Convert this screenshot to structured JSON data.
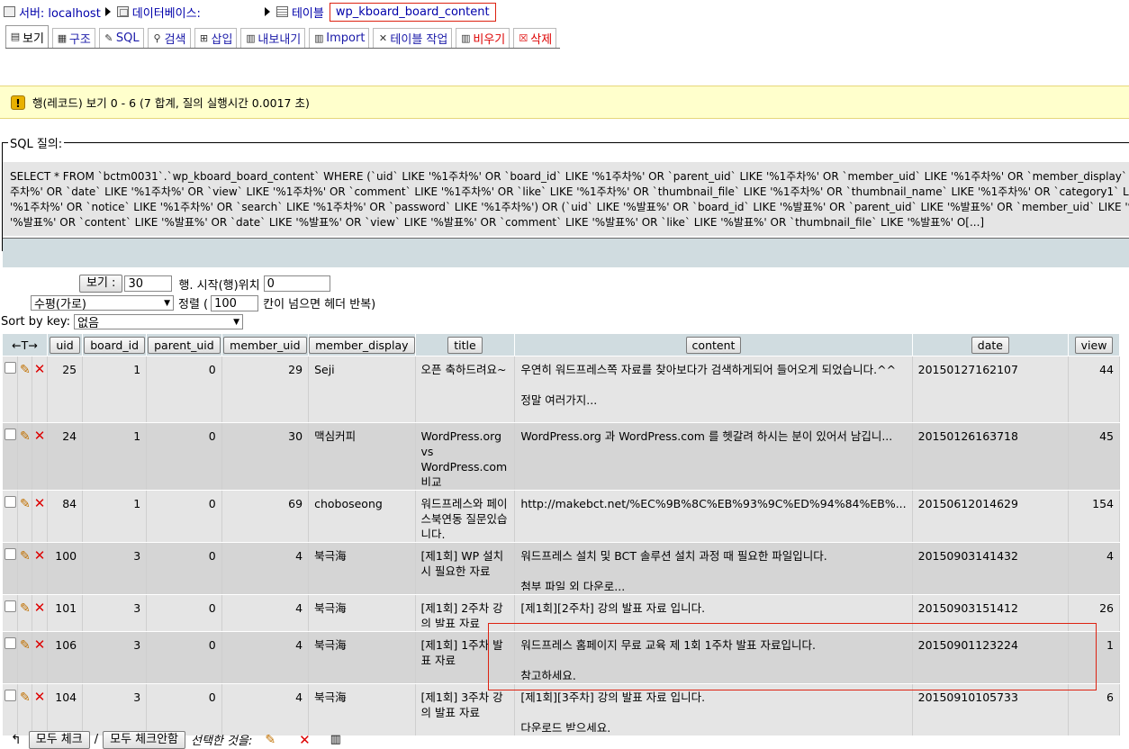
{
  "breadcrumb": {
    "server_label": "서버: localhost",
    "database_label": "데이터베이스:",
    "table_label": "테이블",
    "table_name": "wp_kboard_board_content"
  },
  "tabs": [
    {
      "label": "보기",
      "icon": "browse-icon"
    },
    {
      "label": "구조",
      "icon": "structure-icon"
    },
    {
      "label": "SQL",
      "icon": "sql-icon"
    },
    {
      "label": "검색",
      "icon": "search-icon"
    },
    {
      "label": "삽입",
      "icon": "insert-icon"
    },
    {
      "label": "내보내기",
      "icon": "export-icon"
    },
    {
      "label": "Import",
      "icon": "import-icon"
    },
    {
      "label": "테이블 작업",
      "icon": "tools-icon"
    },
    {
      "label": "비우기",
      "icon": "empty-icon"
    },
    {
      "label": "삭제",
      "icon": "drop-icon"
    }
  ],
  "notice": "행(레코드) 보기 0 - 6 (7 합계, 질의 실행시간 0.0017 초)",
  "sql": {
    "legend": "SQL 질의:",
    "lines": [
      "SELECT * FROM `bctm0031`.`wp_kboard_board_content` WHERE (`uid` LIKE '%1주차%' OR `board_id` LIKE '%1주차%' OR `parent_uid` LIKE '%1주차%' OR `member_uid` LIKE '%1주차%' OR `member_display` LIKE",
      "주차%' OR `date` LIKE '%1주차%' OR `view` LIKE '%1주차%' OR `comment` LIKE '%1주차%' OR `like` LIKE '%1주차%' OR `thumbnail_file` LIKE '%1주차%' OR `thumbnail_name` LIKE '%1주차%' OR `category1` LIK",
      "'%1주차%' OR `notice` LIKE '%1주차%' OR `search` LIKE '%1주차%' OR `password` LIKE '%1주차%') OR (`uid` LIKE '%발표%' OR `board_id` LIKE '%발표%' OR `parent_uid` LIKE '%발표%' OR `member_uid` LIKE '%",
      "'%발표%' OR `content` LIKE '%발표%' OR `date` LIKE '%발표%' OR `view` LIKE '%발표%' OR `comment` LIKE '%발표%' OR `like` LIKE '%발표%' OR `thumbnail_file` LIKE '%발표%' O[...]"
    ]
  },
  "nav": {
    "show_button": "보기 :",
    "rows_value": "30",
    "start_label": "행. 시작(행)위치",
    "start_value": "0",
    "mode_value": "수평(가로)",
    "align_label": "정렬 (",
    "repeat_value": "100",
    "repeat_label": "칸이 넘으면 헤더 반복)",
    "sort_label": "Sort by key:",
    "sort_value": "없음"
  },
  "table": {
    "arrows": "←T→",
    "columns": [
      "uid",
      "board_id",
      "parent_uid",
      "member_uid",
      "member_display",
      "title",
      "content",
      "date",
      "view"
    ],
    "rows": [
      {
        "uid": "25",
        "board_id": "1",
        "parent_uid": "0",
        "member_uid": "29",
        "member_display": "Seji",
        "title": "오픈 축하드려요~",
        "content": "우연히 워드프레스쪽 자료를 찾아보다가 검색하게되어 들어오게 되었습니다.^^\n\n정말 여러가지...",
        "date": "20150127162107",
        "view": "44"
      },
      {
        "uid": "24",
        "board_id": "1",
        "parent_uid": "0",
        "member_uid": "30",
        "member_display": "맥심커피",
        "title": "WordPress.org vs WordPress.com 비교",
        "content": "WordPress.org 과 WordPress.com 를 헷갈려 하시는 분이 있어서 남깁니...",
        "date": "20150126163718",
        "view": "45"
      },
      {
        "uid": "84",
        "board_id": "1",
        "parent_uid": "0",
        "member_uid": "69",
        "member_display": "choboseong",
        "title": "워드프레스와 페이스북연동 질문있습니다.",
        "content": "http://makebct.net/%EC%9B%8C%EB%93%9C%ED%94%84%EB%...",
        "date": "20150612014629",
        "view": "154"
      },
      {
        "uid": "100",
        "board_id": "3",
        "parent_uid": "0",
        "member_uid": "4",
        "member_display": "북극海",
        "title": "[제1회] WP 설치 시 필요한 자료",
        "content": "워드프레스 설치 및 BCT 솔루션 설치 과정 때 필요한 파일입니다.\n\n첨부 파일 외 다운로...",
        "date": "20150903141432",
        "view": "4"
      },
      {
        "uid": "101",
        "board_id": "3",
        "parent_uid": "0",
        "member_uid": "4",
        "member_display": "북극海",
        "title": "[제1회] 2주차 강의 발표 자료",
        "content": "[제1회][2주차] 강의 발표 자료 입니다.",
        "date": "20150903151412",
        "view": "26"
      },
      {
        "uid": "106",
        "board_id": "3",
        "parent_uid": "0",
        "member_uid": "4",
        "member_display": "북극海",
        "title": "[제1회] 1주차 발표 자료",
        "content": "워드프레스 홈페이지 무료 교육 제 1회 1주차 발표 자료입니다.\n\n참고하세요.",
        "date": "20150901123224",
        "view": "1"
      },
      {
        "uid": "104",
        "board_id": "3",
        "parent_uid": "0",
        "member_uid": "4",
        "member_display": "북극海",
        "title": "[제1회] 3주차 강의 발표 자료",
        "content": "[제1회][3주차] 강의 발표 자료 입니다.\n\n다운로드 받으세요.",
        "date": "20150910105733",
        "view": "6"
      }
    ]
  },
  "footer": {
    "check_all": "모두 체크",
    "separator": "/",
    "uncheck_all": "모두 체크안함",
    "with_selected": "선택한 것을:"
  }
}
